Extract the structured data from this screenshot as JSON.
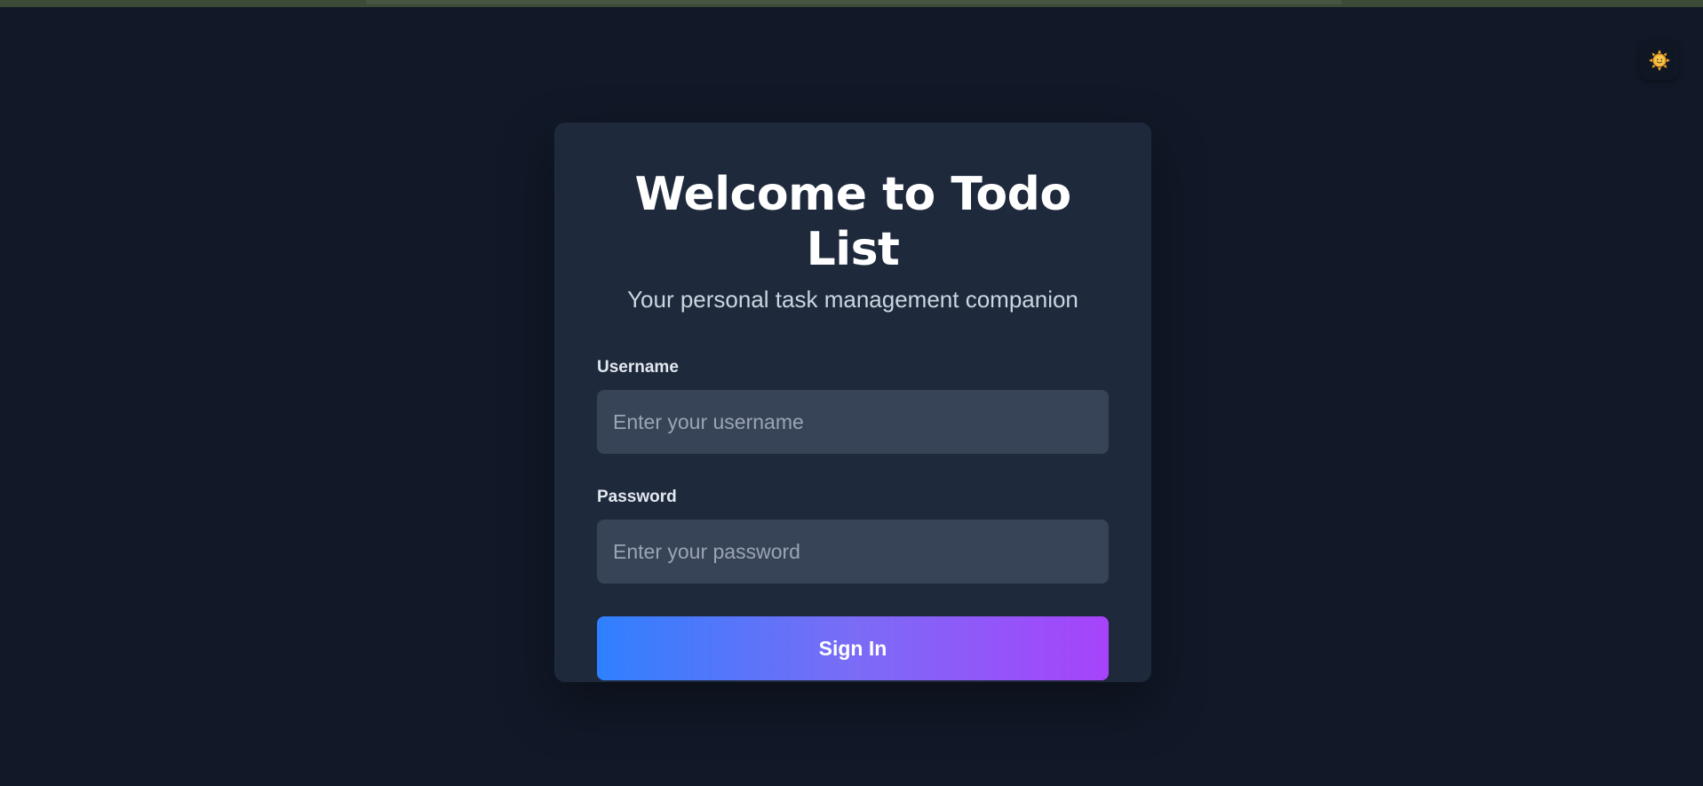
{
  "login": {
    "title": "Welcome to Todo List",
    "subtitle": "Your personal task management companion",
    "username": {
      "label": "Username",
      "value": "",
      "placeholder": "Enter your username"
    },
    "password": {
      "label": "Password",
      "value": "",
      "placeholder": "Enter your password"
    },
    "submit_label": "Sign In"
  },
  "theme_toggle": {
    "icon": "sun-icon"
  },
  "colors": {
    "background": "#111827",
    "card": "#1e293b",
    "input": "#374357",
    "gradient_start": "#2f80fe",
    "gradient_end": "#a743fb"
  }
}
